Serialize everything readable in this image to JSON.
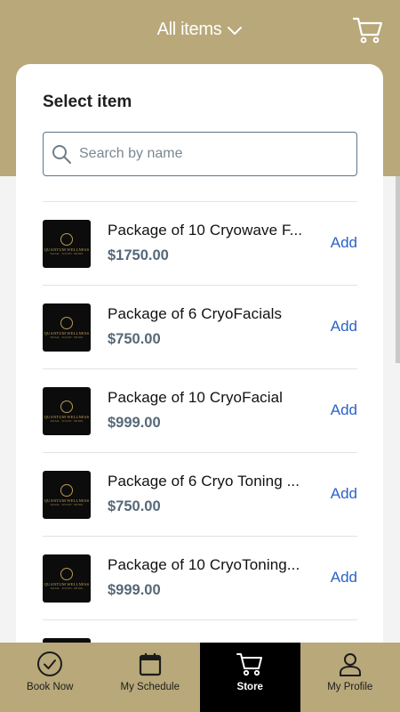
{
  "header": {
    "title": "All items",
    "title_icon": "chevron-down-icon",
    "cart_icon": "cart-icon"
  },
  "panel": {
    "title": "Select item",
    "search": {
      "placeholder": "Search by name",
      "value": ""
    }
  },
  "items": [
    {
      "name": "Package of 10 Cryowave F...",
      "price": "$1750.00",
      "action": "Add",
      "thumb": {
        "brand": "QUANTUM WELLNESS",
        "sub": "FACIAL · SCULPT · DETOX"
      }
    },
    {
      "name": "Package of 6 CryoFacials",
      "price": "$750.00",
      "action": "Add",
      "thumb": {
        "brand": "QUANTUM WELLNESS",
        "sub": "FACIAL · SCULPT · DETOX"
      }
    },
    {
      "name": "Package of 10 CryoFacial",
      "price": "$999.00",
      "action": "Add",
      "thumb": {
        "brand": "QUANTUM WELLNESS",
        "sub": "FACIAL · SCULPT · DETOX"
      }
    },
    {
      "name": "Package of 6 Cryo Toning ...",
      "price": "$750.00",
      "action": "Add",
      "thumb": {
        "brand": "QUANTUM WELLNESS",
        "sub": "FACIAL · SCULPT · DETOX"
      }
    },
    {
      "name": "Package of 10 CryoToning...",
      "price": "$999.00",
      "action": "Add",
      "thumb": {
        "brand": "QUANTUM WELLNESS",
        "sub": "FACIAL · SCULPT · DETOX"
      }
    }
  ],
  "tabs": [
    {
      "label": "Book Now",
      "icon": "check-circle-icon",
      "active": false
    },
    {
      "label": "My Schedule",
      "icon": "calendar-icon",
      "active": false
    },
    {
      "label": "Store",
      "icon": "cart-icon",
      "active": true
    },
    {
      "label": "My Profile",
      "icon": "profile-icon",
      "active": false
    }
  ],
  "colors": {
    "header": "#b8a87a",
    "accent_link": "#2a62c9",
    "active_tab": "#000000",
    "price": "#556878"
  }
}
